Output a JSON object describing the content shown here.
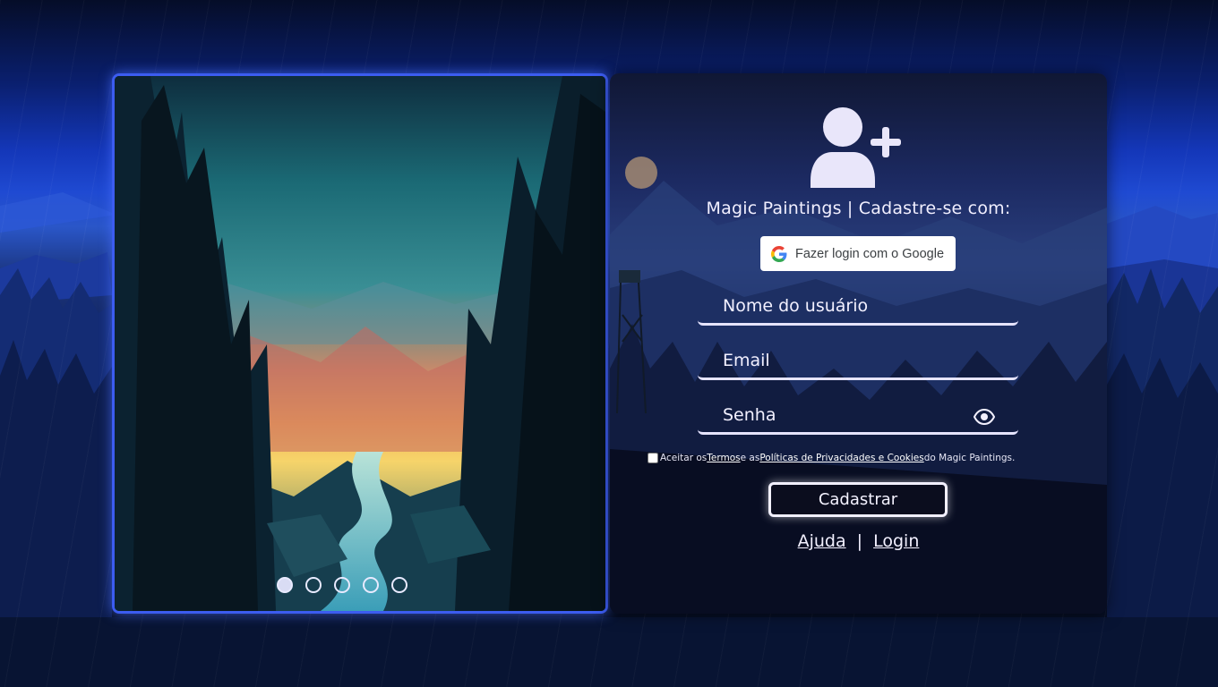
{
  "form": {
    "brand_line": "Magic Paintings | Cadastre-se com:",
    "google_button_label": "Fazer login com o Google",
    "username_placeholder": "Nome do usuário",
    "email_placeholder": "Email",
    "password_placeholder": "Senha",
    "terms": {
      "prefix": "Aceitar os",
      "terms_link": "Termos",
      "middle": "e as",
      "privacy_link": "Políticas de Privacidades e Cookies",
      "suffix": "do Magic Paintings.",
      "checked": false
    },
    "submit_label": "Cadastrar",
    "help_link": "Ajuda",
    "separator": "|",
    "login_link": "Login"
  },
  "carousel": {
    "total_slides": 5,
    "active_index": 0
  },
  "icons": {
    "user_add": "user-plus-icon",
    "google": "google-g-icon",
    "password_toggle": "eye-icon"
  },
  "colors": {
    "panel_border": "#3c5cf0",
    "input_line": "#e6e4ff",
    "text": "#f2f0ff"
  }
}
